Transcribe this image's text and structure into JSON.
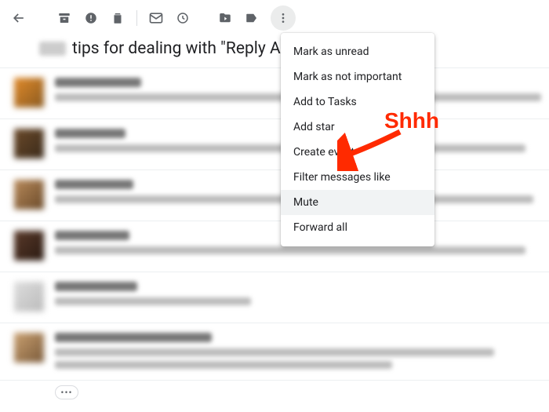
{
  "subject": "tips for dealing with \"Reply All",
  "toolbar": {
    "icons": [
      "back",
      "archive",
      "spam",
      "delete",
      "unread",
      "snooze",
      "move",
      "label",
      "more"
    ]
  },
  "menu": {
    "items": [
      {
        "label": "Mark as unread",
        "hover": false
      },
      {
        "label": "Mark as not important",
        "hover": false
      },
      {
        "label": "Add to Tasks",
        "hover": false
      },
      {
        "label": "Add star",
        "hover": false
      },
      {
        "label": "Create event",
        "hover": false
      },
      {
        "label": "Filter messages like",
        "hover": false
      },
      {
        "label": "Mute",
        "hover": true
      },
      {
        "label": "Forward all",
        "hover": false
      }
    ]
  },
  "annotation": {
    "text": "Shhh",
    "color": "#ff2a00"
  },
  "messages": [
    {
      "avatar_color": "linear-gradient(135deg,#e08a2a,#8a5a20)",
      "sender_w": 110,
      "snippet_w": 620
    },
    {
      "avatar_color": "linear-gradient(135deg,#6b4a2a,#3a2a1a)",
      "sender_w": 90,
      "snippet_w": 600
    },
    {
      "avatar_color": "linear-gradient(135deg,#b88a5a,#6a4a2a)",
      "sender_w": 100,
      "snippet_w": 610
    },
    {
      "avatar_color": "linear-gradient(135deg,#5a3a2a,#2a1a12)",
      "sender_w": 95,
      "snippet_w": 600
    },
    {
      "avatar_color": "linear-gradient(135deg,#ddd,#bbb)",
      "sender_w": 105,
      "snippet_w": 250
    },
    {
      "avatar_color": "linear-gradient(135deg,#c9a070,#7a5a3a)",
      "sender_w": 200,
      "snippet_w": 560,
      "extra": true
    }
  ]
}
